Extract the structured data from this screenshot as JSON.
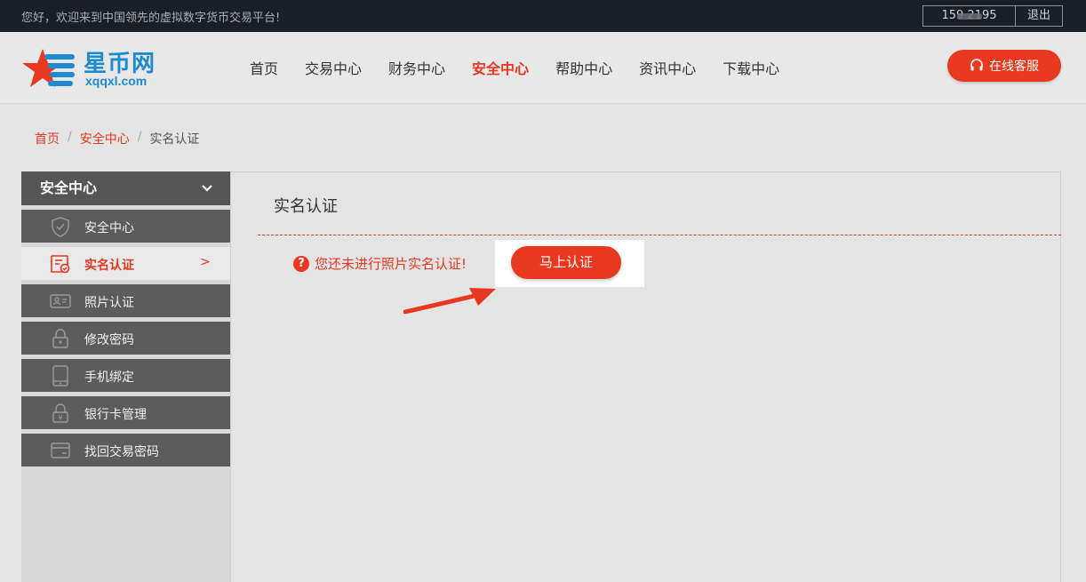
{
  "topbar": {
    "welcome": "您好，欢迎来到中国领先的虚拟数字货币交易平台!",
    "phone": "159        2195",
    "logout": "退出"
  },
  "header": {
    "logo_brand": "星币网",
    "logo_domain": "xqqxl.com",
    "nav": [
      "首页",
      "交易中心",
      "财务中心",
      "安全中心",
      "帮助中心",
      "资讯中心",
      "下载中心"
    ],
    "nav_active_index": 3,
    "service_button": "在线客服",
    "accent_color": "#e8381f"
  },
  "breadcrumb": {
    "home": "首页",
    "section": "安全中心",
    "current": "实名认证",
    "separator": "/"
  },
  "sidebar": {
    "title": "安全中心",
    "items": [
      {
        "label": "安全中心",
        "icon": "shield-icon"
      },
      {
        "label": "实名认证",
        "icon": "id-verify-icon",
        "active": true,
        "arrow": ">"
      },
      {
        "label": "照片认证",
        "icon": "id-card-icon"
      },
      {
        "label": "修改密码",
        "icon": "lock-icon"
      },
      {
        "label": "手机绑定",
        "icon": "phone-icon"
      },
      {
        "label": "银行卡管理",
        "icon": "bank-lock-icon"
      },
      {
        "label": "找回交易密码",
        "icon": "card-icon"
      }
    ]
  },
  "main": {
    "title": "实名认证",
    "notice": "您还未进行照片实名认证!",
    "notice_icon": "?",
    "verify_button": "马上认证"
  }
}
